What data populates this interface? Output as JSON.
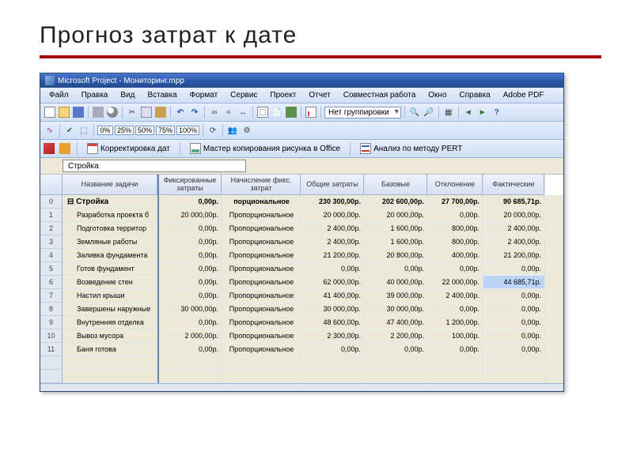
{
  "slide": {
    "title": "Прогноз затрат к дате"
  },
  "window": {
    "title": "Microsoft Project - Мониторинг.mpp"
  },
  "menu": [
    "Файл",
    "Правка",
    "Вид",
    "Вставка",
    "Формат",
    "Сервис",
    "Проект",
    "Отчет",
    "Совместная работа",
    "Окно",
    "Справка",
    "Adobe PDF"
  ],
  "toolbar": {
    "grouping_select": "Нет группировки",
    "zoom_levels": [
      "0%",
      "25%",
      "50%",
      "75%",
      "100%"
    ]
  },
  "toolbar3": {
    "btn1": "Корректировка дат",
    "btn2": "Мастер копирования рисунка в Office",
    "btn3": "Анализ по методу PERT"
  },
  "name_entry": "Стройка",
  "columns": {
    "task": "Название задачи",
    "fixed": "Фиксированные затраты",
    "accrual": "Начисление фикс. затрат",
    "total": "Общие затраты",
    "base": "Базовые",
    "deviation": "Отклонение",
    "actual": "Фактические"
  },
  "rows": [
    {
      "id": "0",
      "task": "⊟ Стройка",
      "bold": true,
      "fixed": "0,00р.",
      "accrual": "порциональное",
      "accr_bold": true,
      "total": "230 300,00р.",
      "base": "202 600,00р.",
      "dev": "27 700,00р.",
      "act": "90 685,71р."
    },
    {
      "id": "1",
      "task": "Разработка проекта б",
      "fixed": "20 000,00р.",
      "accrual": "Пропорциональное",
      "total": "20 000,00р.",
      "base": "20 000,00р.",
      "dev": "0,00р.",
      "act": "20 000,00р."
    },
    {
      "id": "2",
      "task": "Подготовка территор",
      "fixed": "0,00р.",
      "accrual": "Пропорциональное",
      "total": "2 400,00р.",
      "base": "1 600,00р.",
      "dev": "800,00р.",
      "act": "2 400,00р."
    },
    {
      "id": "3",
      "task": "Земляные работы",
      "fixed": "0,00р.",
      "accrual": "Пропорциональное",
      "total": "2 400,00р.",
      "base": "1 600,00р.",
      "dev": "800,00р.",
      "act": "2 400,00р."
    },
    {
      "id": "4",
      "task": "Заливка фундамента",
      "fixed": "0,00р.",
      "accrual": "Пропорциональное",
      "total": "21 200,00р.",
      "base": "20 800,00р.",
      "dev": "400,00р.",
      "act": "21 200,00р."
    },
    {
      "id": "5",
      "task": "Готов фундамент",
      "fixed": "0,00р.",
      "accrual": "Пропорциональное",
      "total": "0,00р.",
      "base": "0,00р.",
      "dev": "0,00р.",
      "act": "0,00р."
    },
    {
      "id": "6",
      "task": "Возведение стен",
      "fixed": "0,00р.",
      "accrual": "Пропорциональное",
      "total": "62 000,00р.",
      "base": "40 000,00р.",
      "dev": "22 000,00р.",
      "act": "44 685,71р.",
      "sel": true
    },
    {
      "id": "7",
      "task": "Настил крыши",
      "fixed": "0,00р.",
      "accrual": "Пропорциональное",
      "total": "41 400,00р.",
      "base": "39 000,00р.",
      "dev": "2 400,00р.",
      "act": "0,00р."
    },
    {
      "id": "8",
      "task": "Завершены наружные",
      "fixed": "30 000,00р.",
      "accrual": "Пропорциональное",
      "total": "30 000,00р.",
      "base": "30 000,00р.",
      "dev": "0,00р.",
      "act": "0,00р."
    },
    {
      "id": "9",
      "task": "Внутренняя отделка",
      "fixed": "0,00р.",
      "accrual": "Пропорциональное",
      "total": "48 600,00р.",
      "base": "47 400,00р.",
      "dev": "1 200,00р.",
      "act": "0,00р."
    },
    {
      "id": "10",
      "task": "Вывоз мусора",
      "fixed": "2 000,00р.",
      "accrual": "Пропорциональное",
      "total": "2 300,00р.",
      "base": "2 200,00р.",
      "dev": "100,00р.",
      "act": "0,00р."
    },
    {
      "id": "11",
      "task": "Баня готова",
      "fixed": "0,00р.",
      "accrual": "Пропорциональное",
      "total": "0,00р.",
      "base": "0,00р.",
      "dev": "0,00р.",
      "act": "0,00р."
    }
  ]
}
